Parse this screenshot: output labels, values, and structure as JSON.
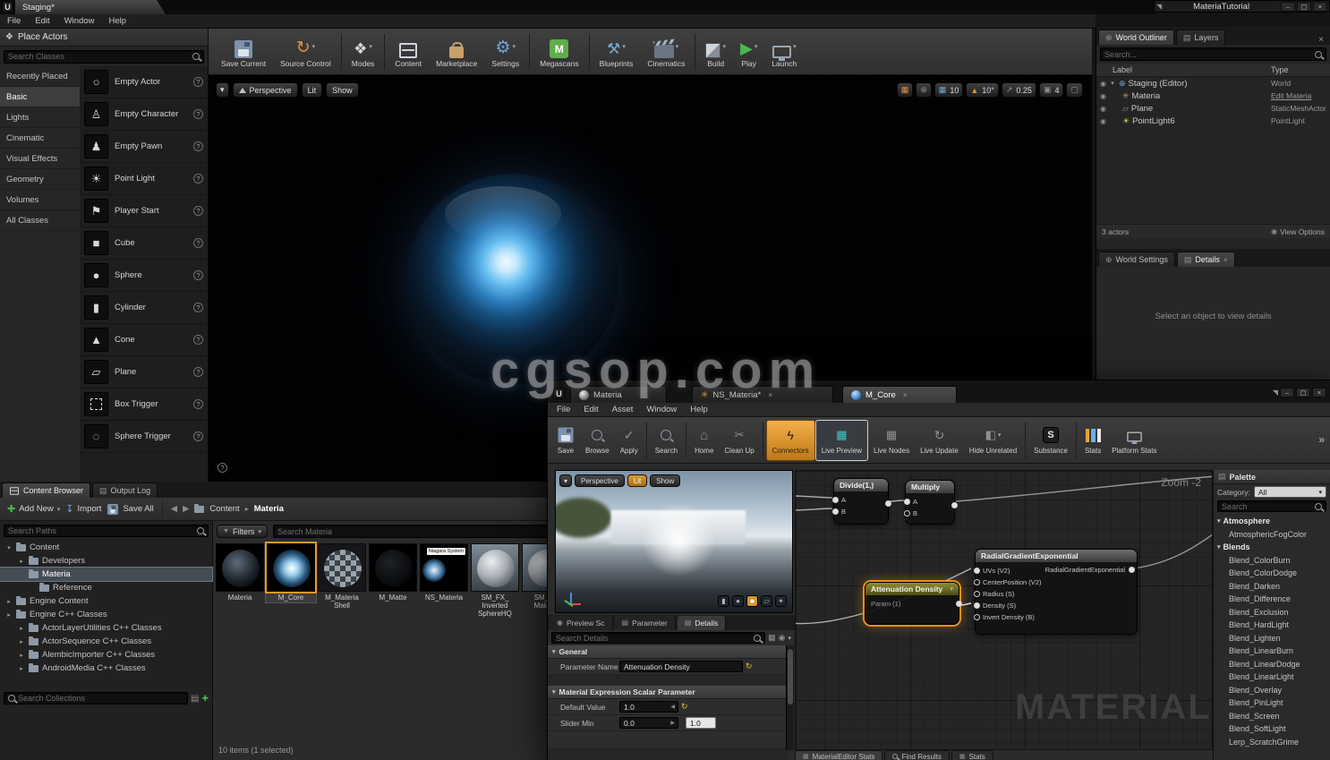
{
  "watermark": "cgsop.com",
  "icons": {
    "unreal": "U",
    "caret_down": "▾",
    "caret_right": "▸",
    "tri_down": "▼",
    "back": "◀",
    "forward": "▶",
    "close": "×",
    "minimize": "–",
    "maximize": "▢",
    "pin": "◥",
    "chevrons": "»",
    "gear": "⚙",
    "play": "▶",
    "home": "⌂",
    "refresh": "↻",
    "grid": "▦",
    "globe": "⊕",
    "eye": "◉",
    "layers": "▤",
    "plus": "✚",
    "question": "?",
    "import": "↧",
    "modes": "❖",
    "tools": "⚒",
    "warning": "▲",
    "diag": "↗",
    "camera": "▣",
    "frame": "▢",
    "empty_actor": "○",
    "empty_character": "♙",
    "empty_pawn": "♟",
    "point_light": "☀",
    "player_start": "⚑",
    "cube": "■",
    "sphere": "●",
    "cylinder": "▮",
    "cone": "▲",
    "plane": "▱",
    "sphere_trigger": "◌",
    "megascans": "M",
    "substance": "S",
    "niagara": "✳",
    "check": "✓",
    "scissors": "✂",
    "bolt": "ϟ",
    "half": "◧",
    "world": "⊕",
    "bulb": "☀",
    "star": "✦",
    "list": "▤"
  },
  "main": {
    "title_tab": "Staging*",
    "floating_window_title": "MateriaTutorial",
    "menu": {
      "file": "File",
      "edit": "Edit",
      "window": "Window",
      "help": "Help"
    },
    "place_actors": {
      "title": "Place Actors",
      "search_placeholder": "Search Classes",
      "categories": [
        {
          "label": "Recently Placed"
        },
        {
          "label": "Basic"
        },
        {
          "label": "Lights"
        },
        {
          "label": "Cinematic"
        },
        {
          "label": "Visual Effects"
        },
        {
          "label": "Geometry"
        },
        {
          "label": "Volumes"
        },
        {
          "label": "All Classes"
        }
      ],
      "items": [
        {
          "label": "Empty Actor"
        },
        {
          "label": "Empty Character"
        },
        {
          "label": "Empty Pawn"
        },
        {
          "label": "Point Light"
        },
        {
          "label": "Player Start"
        },
        {
          "label": "Cube"
        },
        {
          "label": "Sphere"
        },
        {
          "label": "Cylinder"
        },
        {
          "label": "Cone"
        },
        {
          "label": "Plane"
        },
        {
          "label": "Box Trigger"
        },
        {
          "label": "Sphere Trigger"
        }
      ]
    },
    "toolbar": {
      "save_current": "Save Current",
      "source_control": "Source Control",
      "modes": "Modes",
      "content": "Content",
      "marketplace": "Marketplace",
      "settings": "Settings",
      "megascans": "Megascans",
      "blueprints": "Blueprints",
      "cinematics": "Cinematics",
      "build": "Build",
      "play": "Play",
      "launch": "Launch"
    },
    "viewport": {
      "perspective": "Perspective",
      "lit": "Lit",
      "show": "Show",
      "grid_snap": "10",
      "rotation_snap": "10°",
      "scale_snap": "0.25",
      "camera_speed": "4"
    },
    "outliner": {
      "tab_world_outliner": "World Outliner",
      "tab_layers": "Layers",
      "search_placeholder": "Search...",
      "col_label": "Label",
      "col_type": "Type",
      "rows": [
        {
          "label": "Staging (Editor)",
          "type": "World"
        },
        {
          "label": "Materia",
          "type": "Edit Materia"
        },
        {
          "label": "Plane",
          "type": "StaticMeshActor"
        },
        {
          "label": "PointLight6",
          "type": "PointLight"
        }
      ],
      "actor_count": "3 actors",
      "view_options": "View Options"
    },
    "details_panel": {
      "tab_world_settings": "World Settings",
      "tab_details": "Details",
      "empty_message": "Select an object to view details"
    },
    "content_browser": {
      "tab_content_browser": "Content Browser",
      "tab_output_log": "Output Log",
      "add_new": "Add New",
      "import": "Import",
      "save_all": "Save All",
      "breadcrumb": [
        "Content",
        "Materia"
      ],
      "search_paths_placeholder": "Search Paths",
      "tree": [
        {
          "label": "Content"
        },
        {
          "label": "Developers"
        },
        {
          "label": "Materia"
        },
        {
          "label": "Reference"
        },
        {
          "label": "Engine Content"
        },
        {
          "label": "Engine C++ Classes"
        },
        {
          "label": "ActorLayerUtilities C++ Classes"
        },
        {
          "label": "ActorSequence C++ Classes"
        },
        {
          "label": "AlembicImporter C++ Classes"
        },
        {
          "label": "AndroidMedia C++ Classes"
        }
      ],
      "search_collections_placeholder": "Search Collections",
      "filters": "Filters",
      "search_assets_placeholder": "Search Materia",
      "assets": [
        {
          "name": "Materia"
        },
        {
          "name": "M_Core"
        },
        {
          "name": "M_Materia Shell"
        },
        {
          "name": "M_Matte"
        },
        {
          "name": "NS_Materia",
          "badge": "Niagara System"
        },
        {
          "name": "SM_FX_ Inverted SphereHQ"
        },
        {
          "name": "SM_FX Materia"
        }
      ],
      "status": "10 items (1 selected)"
    }
  },
  "material": {
    "tabs": [
      {
        "label": "Materia"
      },
      {
        "label": "NS_Materia*"
      },
      {
        "label": "M_Core"
      }
    ],
    "menu": {
      "file": "File",
      "edit": "Edit",
      "asset": "Asset",
      "window": "Window",
      "help": "Help"
    },
    "toolbar": {
      "save": "Save",
      "browse": "Browse",
      "apply": "Apply",
      "search": "Search",
      "home": "Home",
      "clean_up": "Clean Up",
      "connectors": "Connectors",
      "live_preview": "Live Preview",
      "live_nodes": "Live Nodes",
      "live_update": "Live Update",
      "hide_unrelated": "Hide Unrelated",
      "substance": "Substance",
      "stats": "Stats",
      "platform_stats": "Platform Stats"
    },
    "preview": {
      "perspective": "Perspective",
      "lit": "Lit",
      "show": "Show"
    },
    "panel_tabs": {
      "preview_scene": "Preview Sc",
      "parameter": "Parameter",
      "details": "Details"
    },
    "details": {
      "search_placeholder": "Search Details",
      "section_general": "General",
      "parameter_name_label": "Parameter Name",
      "parameter_name_value": "Attenuation Density",
      "section_scalar": "Material Expression Scalar Parameter",
      "default_value_label": "Default Value",
      "default_value": "1.0",
      "slider_min_label": "Slider Min",
      "slider_min_value": "0.0",
      "slider_max_value": "1.0"
    },
    "graph": {
      "zoom": "Zoom -2",
      "watermark": "MATERIAL",
      "divide": {
        "title": "Divide(1,)",
        "pin_a": "A",
        "pin_b": "B"
      },
      "multiply": {
        "title": "Multiply",
        "pin_a": "A",
        "pin_b": "B"
      },
      "radial": {
        "title": "RadialGradientExponential",
        "pins": [
          {
            "label": "UVs (V2)"
          },
          {
            "label": "CenterPosition (V2)"
          },
          {
            "label": "Radius (S)"
          },
          {
            "label": "Density (S)"
          },
          {
            "label": "Invert Density (B)"
          }
        ],
        "output": "RadialGradientExponential"
      },
      "attenuation": {
        "title": "Attenuation Density",
        "body": "Param (1)"
      }
    },
    "bottom_tabs": {
      "material_stats": "MaterialEditor Stats",
      "find_results": "Find Results",
      "stats": "Stats"
    },
    "palette": {
      "title": "Palette",
      "category_label": "Category:",
      "category_value": "All",
      "search_placeholder": "Search",
      "items": [
        {
          "label": "Atmosphere"
        },
        {
          "label": "AtmosphericFogColor"
        },
        {
          "label": "Blends"
        },
        {
          "label": "Blend_ColorBurn"
        },
        {
          "label": "Blend_ColorDodge"
        },
        {
          "label": "Blend_Darken"
        },
        {
          "label": "Blend_Difference"
        },
        {
          "label": "Blend_Exclusion"
        },
        {
          "label": "Blend_HardLight"
        },
        {
          "label": "Blend_Lighten"
        },
        {
          "label": "Blend_LinearBurn"
        },
        {
          "label": "Blend_LinearDodge"
        },
        {
          "label": "Blend_LinearLight"
        },
        {
          "label": "Blend_Overlay"
        },
        {
          "label": "Blend_PinLight"
        },
        {
          "label": "Blend_Screen"
        },
        {
          "label": "Blend_SoftLight"
        },
        {
          "label": "Lerp_ScratchGrime"
        }
      ]
    }
  }
}
